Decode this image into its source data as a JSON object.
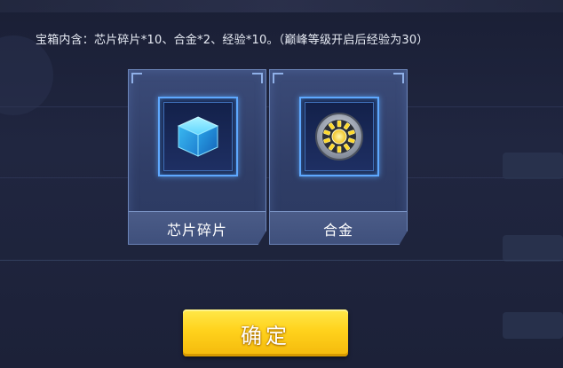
{
  "dialog": {
    "description": "宝箱内含：芯片碎片*10、合金*2、经验*10。（巅峰等级开启后经验为30）",
    "items": [
      {
        "name": "芯片碎片",
        "icon": "blue-cube-icon"
      },
      {
        "name": "合金",
        "icon": "arc-reactor-icon"
      }
    ],
    "confirm_label": "确定"
  },
  "colors": {
    "background": "#1d2238",
    "card": "#34436e",
    "frame_glow": "#5ea8ff",
    "confirm_button": "#ffd21c"
  }
}
